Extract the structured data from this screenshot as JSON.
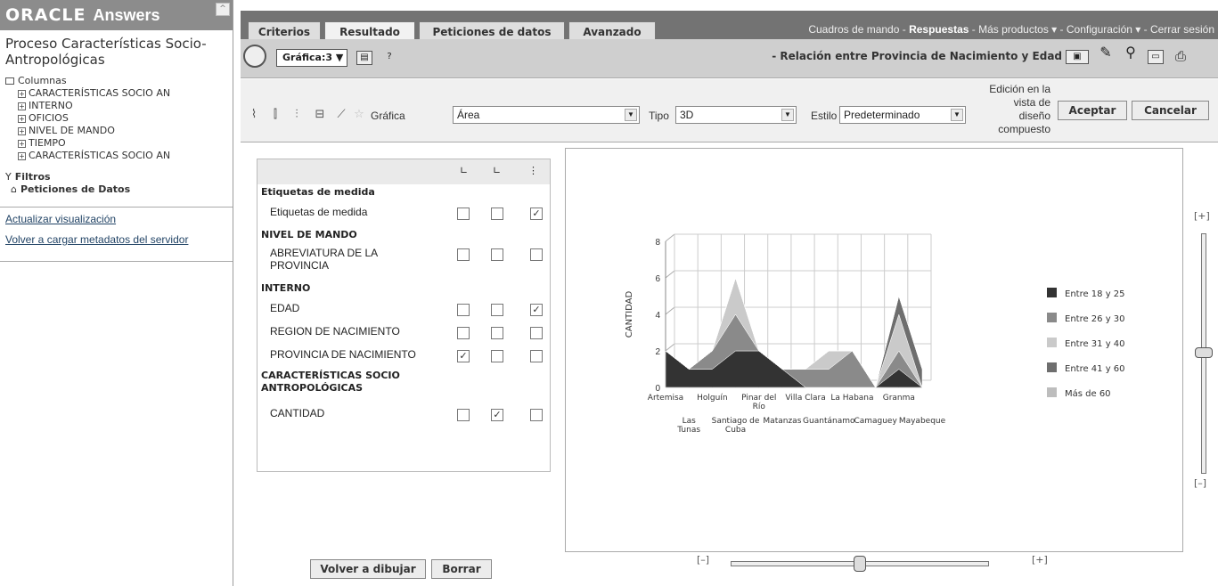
{
  "app": {
    "logo": "ORACLE",
    "product": "Answers"
  },
  "left": {
    "subject_area": "Proceso Características Socio-Antropológicas",
    "columns_label": "Columnas",
    "folders": [
      "CARACTERÍSTICAS SOCIO AN",
      "INTERNO",
      "OFICIOS",
      "NIVEL DE MANDO",
      "TIEMPO",
      "CARACTERÍSTICAS SOCIO AN"
    ],
    "filters_label": "Filtros",
    "saved_requests_label": "Peticiones de Datos",
    "link_refresh": "Actualizar visualización",
    "link_reload": "Volver a cargar metadatos del servidor"
  },
  "tabs": [
    "Criterios",
    "Resultado",
    "Peticiones de datos",
    "Avanzado"
  ],
  "active_tab": "Resultado",
  "toplinks": {
    "dashboards": "Cuadros de mando",
    "answers": "Respuestas",
    "more": "Más productos",
    "config": "Configuración",
    "logout": "Cerrar sesión"
  },
  "toolbar": {
    "view_selector": "Gráfica:3",
    "chart_title": "- Relación entre Provincia de Nacimiento y Edad"
  },
  "props": {
    "grafica_label": "Gráfica",
    "grafica_value": "Área",
    "tipo_label": "Tipo",
    "tipo_value": "3D",
    "estilo_label": "Estilo",
    "estilo_value": "Predeterminado",
    "design_note": "Edición en la vista de diseño compuesto",
    "accept": "Aceptar",
    "cancel": "Cancelar"
  },
  "columns_panel": {
    "rows": [
      {
        "type": "group",
        "label": "Etiquetas de medida"
      },
      {
        "type": "item",
        "label": "Etiquetas de medida",
        "checks": [
          false,
          false,
          true
        ]
      },
      {
        "type": "group",
        "label": "NIVEL DE MANDO"
      },
      {
        "type": "item",
        "label": "ABREVIATURA DE LA PROVINCIA",
        "checks": [
          false,
          false,
          false
        ]
      },
      {
        "type": "group",
        "label": "INTERNO"
      },
      {
        "type": "item",
        "label": "EDAD",
        "checks": [
          false,
          false,
          true
        ]
      },
      {
        "type": "item",
        "label": "REGION DE NACIMIENTO",
        "checks": [
          false,
          false,
          false
        ]
      },
      {
        "type": "item",
        "label": "PROVINCIA DE NACIMIENTO",
        "checks": [
          true,
          false,
          false
        ]
      },
      {
        "type": "group",
        "label": "CARACTERÍSTICAS SOCIO ANTROPOLÓGICAS"
      },
      {
        "type": "item",
        "label": "CANTIDAD",
        "checks": [
          false,
          true,
          false
        ]
      }
    ]
  },
  "buttons": {
    "redraw": "Volver a dibujar",
    "clear": "Borrar"
  },
  "slider_labels": {
    "minus": "[–]",
    "plus": "[+]"
  },
  "chart_data": {
    "type": "area",
    "title": "",
    "xlabel": "",
    "ylabel": "CANTIDAD",
    "ylim": [
      0,
      8
    ],
    "yticks": [
      0,
      2,
      4,
      6,
      8
    ],
    "categories": [
      "Artemisa",
      "Las Tunas",
      "Holguín",
      "Santiago de Cuba",
      "Pinar del Río",
      "Matanzas",
      "Villa Clara",
      "Guantánamo",
      "La Habana",
      "Camaguey",
      "Granma",
      "Mayabeque"
    ],
    "series": [
      {
        "name": "Entre 18 y 25",
        "color": "#333333",
        "values": [
          2,
          1,
          1,
          2,
          2,
          1,
          0,
          0,
          0,
          0,
          1,
          0
        ]
      },
      {
        "name": "Entre 26 y 30",
        "color": "#8a8a8a",
        "values": [
          0,
          0,
          1,
          2,
          0,
          0,
          1,
          1,
          2,
          0,
          1,
          0
        ]
      },
      {
        "name": "Entre 31 y 40",
        "color": "#cacaca",
        "values": [
          0,
          0,
          0,
          2,
          0,
          0,
          0,
          1,
          0,
          0,
          2,
          0
        ]
      },
      {
        "name": "Entre 41 y 60",
        "color": "#6e6e6e",
        "values": [
          0,
          0,
          0,
          0,
          0,
          0,
          0,
          0,
          0,
          0,
          1,
          1
        ]
      },
      {
        "name": "Más de 60",
        "color": "#bdbdbd",
        "values": [
          0,
          0,
          0,
          0,
          0,
          0,
          0,
          0,
          0,
          0,
          0,
          0
        ]
      }
    ],
    "legend": "right"
  }
}
